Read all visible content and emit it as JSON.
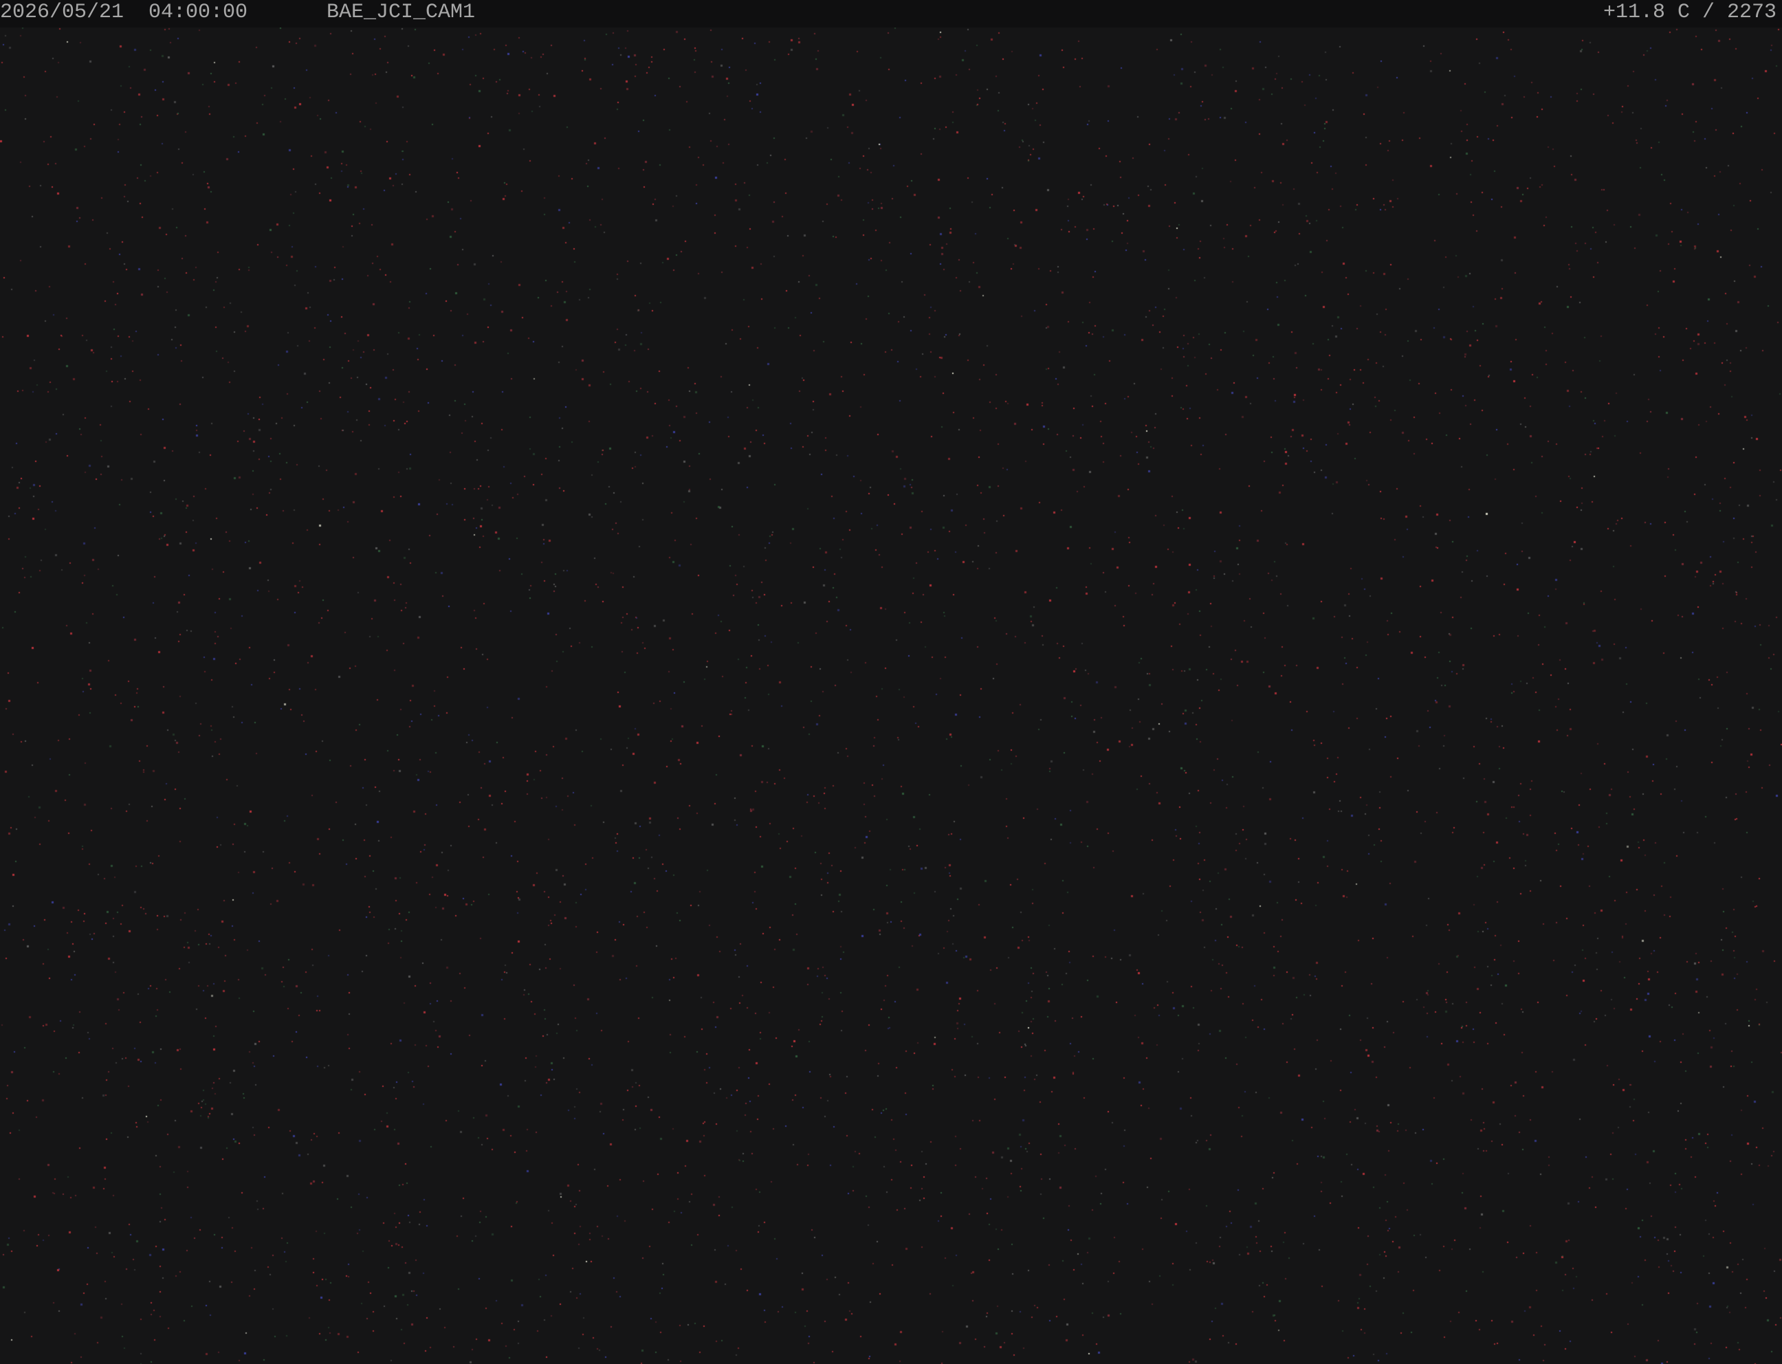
{
  "overlay": {
    "datetime": "2026/05/21  04:00:00",
    "camera_name": "BAE_JCI_CAM1",
    "temperature_count": "+11.8 C / 2273"
  },
  "scene": {
    "description_kind": "dark night-sky camera frame with sensor noise",
    "background_color": "#151516",
    "noise_colors": [
      "#b8323a",
      "#7a2a34",
      "#3a3f9a",
      "#2f5a3a",
      "#5a5a5a",
      "#d0d0c0"
    ]
  }
}
